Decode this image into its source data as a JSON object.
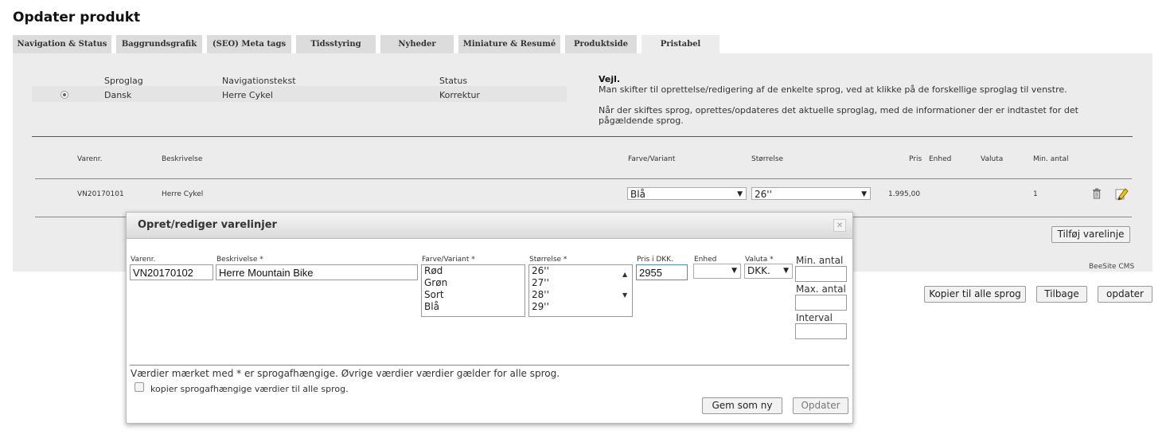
{
  "page": {
    "title": "Opdater produkt"
  },
  "tabs": [
    {
      "label": "Navigation & Status"
    },
    {
      "label": "Baggrundsgrafik"
    },
    {
      "label": "(SEO) Meta tags"
    },
    {
      "label": "Tidsstyring"
    },
    {
      "label": "Nyheder"
    },
    {
      "label": "Miniature & Resumé"
    },
    {
      "label": "Produktside"
    },
    {
      "label": "Pristabel"
    }
  ],
  "lang_table": {
    "headers": {
      "sproglag": "Sproglag",
      "navigationstekst": "Navigationstekst",
      "status": "Status"
    },
    "row": {
      "sproglag": "Dansk",
      "navigationstekst": "Herre Cykel",
      "status": "Korrektur"
    }
  },
  "help": {
    "title": "Vejl.",
    "line1": "Man skifter til oprettelse/redigering af de enkelte sprog, ved at klikke på de forskellige sproglag til venstre.",
    "line2": "Når der skiftes sprog, oprettes/opdateres det aktuelle sproglag, med de informationer der er indtastet for det pågældende sprog."
  },
  "price_table": {
    "headers": {
      "varenr": "Varenr.",
      "beskrivelse": "Beskrivelse",
      "farve": "Farve/Variant",
      "stoerrelse": "Størrelse",
      "pris": "Pris",
      "enhed": "Enhed",
      "valuta": "Valuta",
      "min_antal": "Min. antal"
    },
    "row": {
      "varenr": "VN20170101",
      "beskrivelse": "Herre Cykel",
      "farve": "Blå",
      "stoerrelse": "26''",
      "pris": "1.995,00",
      "min_antal": "1"
    }
  },
  "buttons": {
    "tilfoej": "Tilføj varelinje",
    "kopier": "Kopier til alle sprog",
    "tilbage": "Tilbage",
    "opdater": "opdater"
  },
  "footer": {
    "brand": "BeeSite CMS"
  },
  "modal": {
    "title": "Opret/rediger varelinjer",
    "labels": {
      "varenr": "Varenr.",
      "beskrivelse": "Beskrivelse *",
      "farve": "Farve/Variant *",
      "stoerrelse": "Størrelse *",
      "pris": "Pris i DKK.",
      "enhed": "Enhed",
      "valuta": "Valuta *",
      "min_antal": "Min. antal",
      "max_antal": "Max. antal",
      "interval": "Interval"
    },
    "values": {
      "varenr": "VN20170102",
      "beskrivelse": "Herre Mountain Bike",
      "pris": "2955",
      "enhed": "",
      "valuta": "DKK.",
      "min_antal": "",
      "max_antal": "",
      "interval": ""
    },
    "farve_options": [
      "Rød",
      "Grøn",
      "Sort",
      "Blå"
    ],
    "stoerrelse_options": [
      "26''",
      "27''",
      "28''",
      "29''"
    ],
    "note": "Værdier mærket med * er sprogafhængige. Øvrige værdier værdier gælder for alle sprog.",
    "checkbox_label": "kopier sprogafhængige værdier til alle sprog.",
    "btn_gem": "Gem som ny",
    "btn_opdater": "Opdater"
  }
}
